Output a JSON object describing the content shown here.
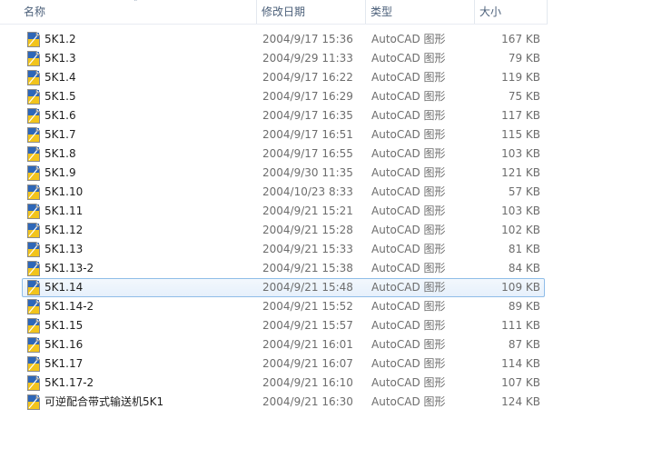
{
  "columns": {
    "name": "名称",
    "date": "修改日期",
    "type": "类型",
    "size": "大小"
  },
  "sort_indicator": "˄",
  "selected_index": 13,
  "files": [
    {
      "name": "5K1.2",
      "date": "2004/9/17 15:36",
      "type": "AutoCAD 图形",
      "size": "167 KB"
    },
    {
      "name": "5K1.3",
      "date": "2004/9/29 11:33",
      "type": "AutoCAD 图形",
      "size": "79 KB"
    },
    {
      "name": "5K1.4",
      "date": "2004/9/17 16:22",
      "type": "AutoCAD 图形",
      "size": "119 KB"
    },
    {
      "name": "5K1.5",
      "date": "2004/9/17 16:29",
      "type": "AutoCAD 图形",
      "size": "75 KB"
    },
    {
      "name": "5K1.6",
      "date": "2004/9/17 16:35",
      "type": "AutoCAD 图形",
      "size": "117 KB"
    },
    {
      "name": "5K1.7",
      "date": "2004/9/17 16:51",
      "type": "AutoCAD 图形",
      "size": "115 KB"
    },
    {
      "name": "5K1.8",
      "date": "2004/9/17 16:55",
      "type": "AutoCAD 图形",
      "size": "103 KB"
    },
    {
      "name": "5K1.9",
      "date": "2004/9/30 11:35",
      "type": "AutoCAD 图形",
      "size": "121 KB"
    },
    {
      "name": "5K1.10",
      "date": "2004/10/23 8:33",
      "type": "AutoCAD 图形",
      "size": "57 KB"
    },
    {
      "name": "5K1.11",
      "date": "2004/9/21 15:21",
      "type": "AutoCAD 图形",
      "size": "103 KB"
    },
    {
      "name": "5K1.12",
      "date": "2004/9/21 15:28",
      "type": "AutoCAD 图形",
      "size": "102 KB"
    },
    {
      "name": "5K1.13",
      "date": "2004/9/21 15:33",
      "type": "AutoCAD 图形",
      "size": "81 KB"
    },
    {
      "name": "5K1.13-2",
      "date": "2004/9/21 15:38",
      "type": "AutoCAD 图形",
      "size": "84 KB"
    },
    {
      "name": "5K1.14",
      "date": "2004/9/21 15:48",
      "type": "AutoCAD 图形",
      "size": "109 KB"
    },
    {
      "name": "5K1.14-2",
      "date": "2004/9/21 15:52",
      "type": "AutoCAD 图形",
      "size": "89 KB"
    },
    {
      "name": "5K1.15",
      "date": "2004/9/21 15:57",
      "type": "AutoCAD 图形",
      "size": "111 KB"
    },
    {
      "name": "5K1.16",
      "date": "2004/9/21 16:01",
      "type": "AutoCAD 图形",
      "size": "87 KB"
    },
    {
      "name": "5K1.17",
      "date": "2004/9/21 16:07",
      "type": "AutoCAD 图形",
      "size": "114 KB"
    },
    {
      "name": "5K1.17-2",
      "date": "2004/9/21 16:10",
      "type": "AutoCAD 图形",
      "size": "107 KB"
    },
    {
      "name": "可逆配合带式输送机5K1",
      "date": "2004/9/21 16:30",
      "type": "AutoCAD 图形",
      "size": "124 KB"
    }
  ],
  "icon": "autocad-dwg-file-icon",
  "colors": {
    "header_text": "#4c607a",
    "meta_text": "#6d6d6d",
    "selection_border": "#8fbde8",
    "icon_yellow": "#f2c41c",
    "icon_blue": "#2e67b8"
  }
}
